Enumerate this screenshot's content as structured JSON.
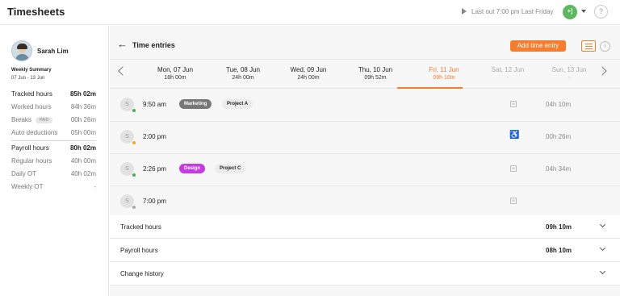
{
  "app": {
    "title": "Timesheets"
  },
  "header": {
    "last_out": "Last out 7:00 pm Last Friday",
    "timer_label": "+]",
    "help_label": "?"
  },
  "sidebar": {
    "user_name": "Sarah Lim",
    "summary_title": "Weekly Summary",
    "week_range": "07 Jun - 13 Jun",
    "paid_badge": "PAID",
    "stats": [
      {
        "label": "Tracked hours",
        "value": "85h 02m"
      },
      {
        "label": "Worked hours",
        "value": "84h 36m"
      },
      {
        "label": "Breaks",
        "value": "00h 26m"
      },
      {
        "label": "Auto deductions",
        "value": "05h 00m"
      },
      {
        "label": "Payroll hours",
        "value": "80h 02m"
      },
      {
        "label": "Regular hours",
        "value": "40h 00m"
      },
      {
        "label": "Daily OT",
        "value": "40h 02m"
      },
      {
        "label": "Weekly OT",
        "value": "-"
      }
    ]
  },
  "main": {
    "title": "Time entries",
    "add_button": "Add time entry",
    "info_label": "i",
    "days": [
      {
        "name": "Mon, 07 Jun",
        "hours": "18h 00m"
      },
      {
        "name": "Tue, 08 Jun",
        "hours": "24h 00m"
      },
      {
        "name": "Wed, 09 Jun",
        "hours": "24h 00m"
      },
      {
        "name": "Thu, 10 Jun",
        "hours": "09h 52m"
      },
      {
        "name": "Fri, 11 Jun",
        "hours": "09h 10m"
      },
      {
        "name": "Sat, 12 Jun",
        "hours": "-"
      },
      {
        "name": "Sun, 13 Jun",
        "hours": "-"
      }
    ],
    "entries": [
      {
        "initial": "S",
        "time": "9:50 am",
        "tag": "Marketing",
        "project": "Project A",
        "icon_label": "M",
        "duration": "04h 10m",
        "dot_color": "#4caf50"
      },
      {
        "initial": "S",
        "time": "2:00 pm",
        "duration": "00h 26m",
        "dot_color": "#f5a623"
      },
      {
        "initial": "S",
        "time": "2:26 pm",
        "tag": "Design",
        "project": "Project C",
        "icon_label": "M",
        "duration": "04h 34m",
        "dot_color": "#4caf50"
      },
      {
        "initial": "S",
        "time": "7:00 pm",
        "icon_label": "M",
        "dot_color": "#aaaaaa"
      }
    ],
    "summary": [
      {
        "label": "Tracked hours",
        "value": "09h 10m"
      },
      {
        "label": "Payroll hours",
        "value": "08h 10m"
      },
      {
        "label": "Change history",
        "value": ""
      }
    ]
  },
  "colors": {
    "accent": "#f47d30",
    "success": "#4caf50",
    "design_tag": "#c43be0"
  }
}
